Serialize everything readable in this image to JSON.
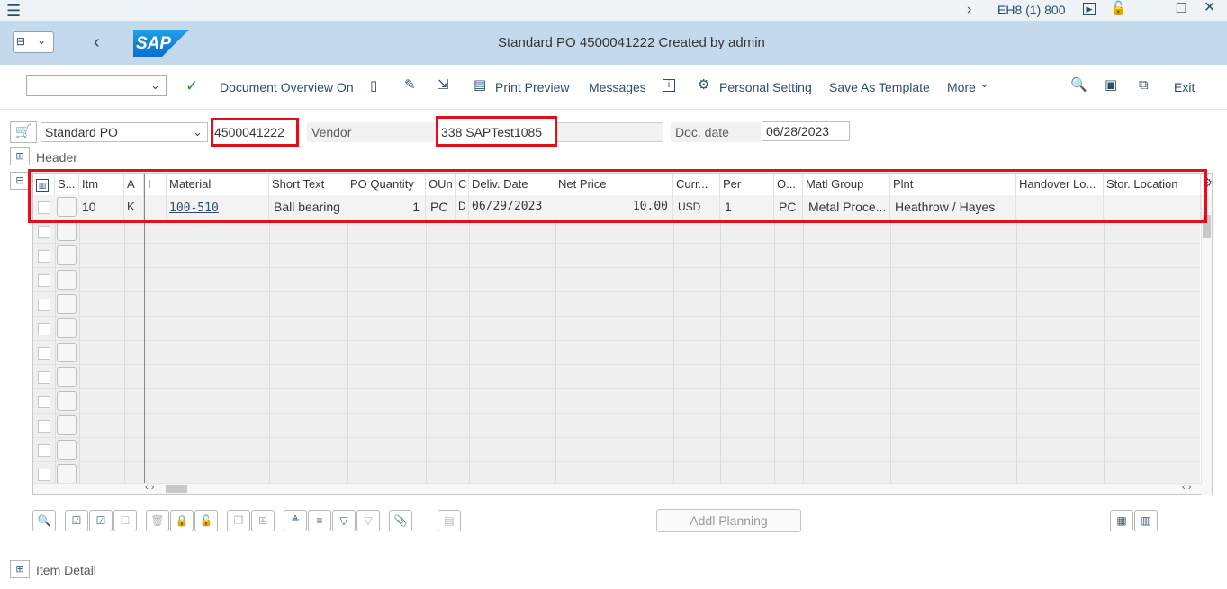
{
  "system": {
    "menu_icon": "hamburger-icon",
    "nav_icon": "chevron-right-icon",
    "session": "EH8 (1) 800"
  },
  "title": {
    "brand": "SAP",
    "text": "Standard PO 4500041222 Created by admin"
  },
  "toolbar": {
    "doc_overview": "Document Overview On",
    "print_preview": "Print Preview",
    "messages": "Messages",
    "personal_setting": "Personal Setting",
    "save_template": "Save As Template",
    "more": "More",
    "exit": "Exit"
  },
  "header": {
    "doc_type": "Standard PO",
    "po_number": "4500041222",
    "vendor_label": "Vendor",
    "vendor_value": "338 SAPTest1085",
    "doc_date_label": "Doc. date",
    "doc_date_value": "06/28/2023",
    "header_label": "Header"
  },
  "table": {
    "columns": [
      "S...",
      "Itm",
      "A",
      "I",
      "Material",
      "Short Text",
      "PO Quantity",
      "OUn",
      "C",
      "Deliv. Date",
      "Net Price",
      "Curr...",
      "Per",
      "O...",
      "Matl Group",
      "Plnt",
      "Handover Lo...",
      "Stor. Location"
    ],
    "row": {
      "itm": "10",
      "a": "K",
      "material": "100-510",
      "short_text": "Ball bearing",
      "po_qty": "1",
      "oun": "PC",
      "c": "D",
      "deliv_date": "06/29/2023",
      "net_price": "10.00",
      "curr": "USD",
      "per": "1",
      "o": "PC",
      "matl_group": "Metal Proce...",
      "plnt": "Heathrow / Hayes"
    }
  },
  "bottom": {
    "addl_planning": "Addl Planning",
    "item_detail": "Item Detail"
  }
}
